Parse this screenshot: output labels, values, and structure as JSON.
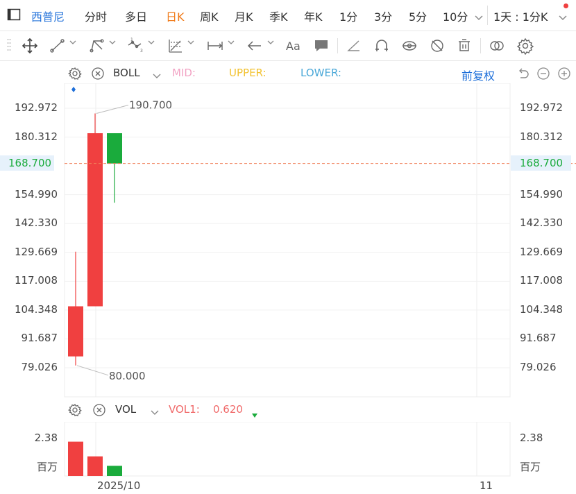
{
  "topbar": {
    "stock_name": "西普尼",
    "periods": [
      "分时",
      "多日",
      "日K",
      "周K",
      "月K",
      "季K",
      "年K",
      "1分",
      "3分",
      "5分",
      "10分"
    ],
    "active_period": "日K",
    "range_label": "1天 : 1分K"
  },
  "main_legend": {
    "indicator": "BOLL",
    "mid_label": "MID:",
    "upper_label": "UPPER:",
    "lower_label": "LOWER:",
    "adjust_label": "前复权"
  },
  "vol_legend": {
    "indicator": "VOL",
    "vol1_label": "VOL1:",
    "vol1_value": "0.620"
  },
  "price_axis": {
    "ticks": [
      "192.972",
      "180.312",
      "168.700",
      "154.990",
      "142.330",
      "129.669",
      "117.008",
      "104.348",
      "91.687",
      "79.026"
    ],
    "current_price": "168.700"
  },
  "annotations": {
    "high_label": "190.700",
    "low_label": "80.000"
  },
  "vol_axis": {
    "top_tick": "2.38",
    "unit": "百万"
  },
  "time_axis": {
    "labels": [
      "2025/10",
      "11"
    ]
  },
  "colors": {
    "up": "#f04040",
    "down": "#1aab3c",
    "accent": "#1e6fd9",
    "active_tab": "#f07b1a",
    "mid": "#f2a3c4",
    "upper": "#f2c230",
    "lower": "#4aa8d8",
    "vol1": "#f06a6a"
  },
  "chart_data": {
    "type": "candlestick",
    "ylim": [
      79.026,
      192.972
    ],
    "yticks": [
      192.972,
      180.312,
      168.7,
      154.99,
      142.33,
      129.669,
      117.008,
      104.348,
      91.687,
      79.026
    ],
    "candles": [
      {
        "open": 84.0,
        "close": 106.0,
        "high": 130.0,
        "low": 80.0,
        "direction": "up"
      },
      {
        "open": 106.0,
        "close": 182.0,
        "high": 190.7,
        "low": 106.0,
        "direction": "up"
      },
      {
        "open": 182.0,
        "close": 168.7,
        "high": 182.0,
        "low": 151.5,
        "direction": "down"
      }
    ],
    "volume": [
      2.1,
      1.2,
      0.62
    ],
    "vol_ylim": [
      0,
      2.38
    ],
    "current_price": 168.7
  }
}
